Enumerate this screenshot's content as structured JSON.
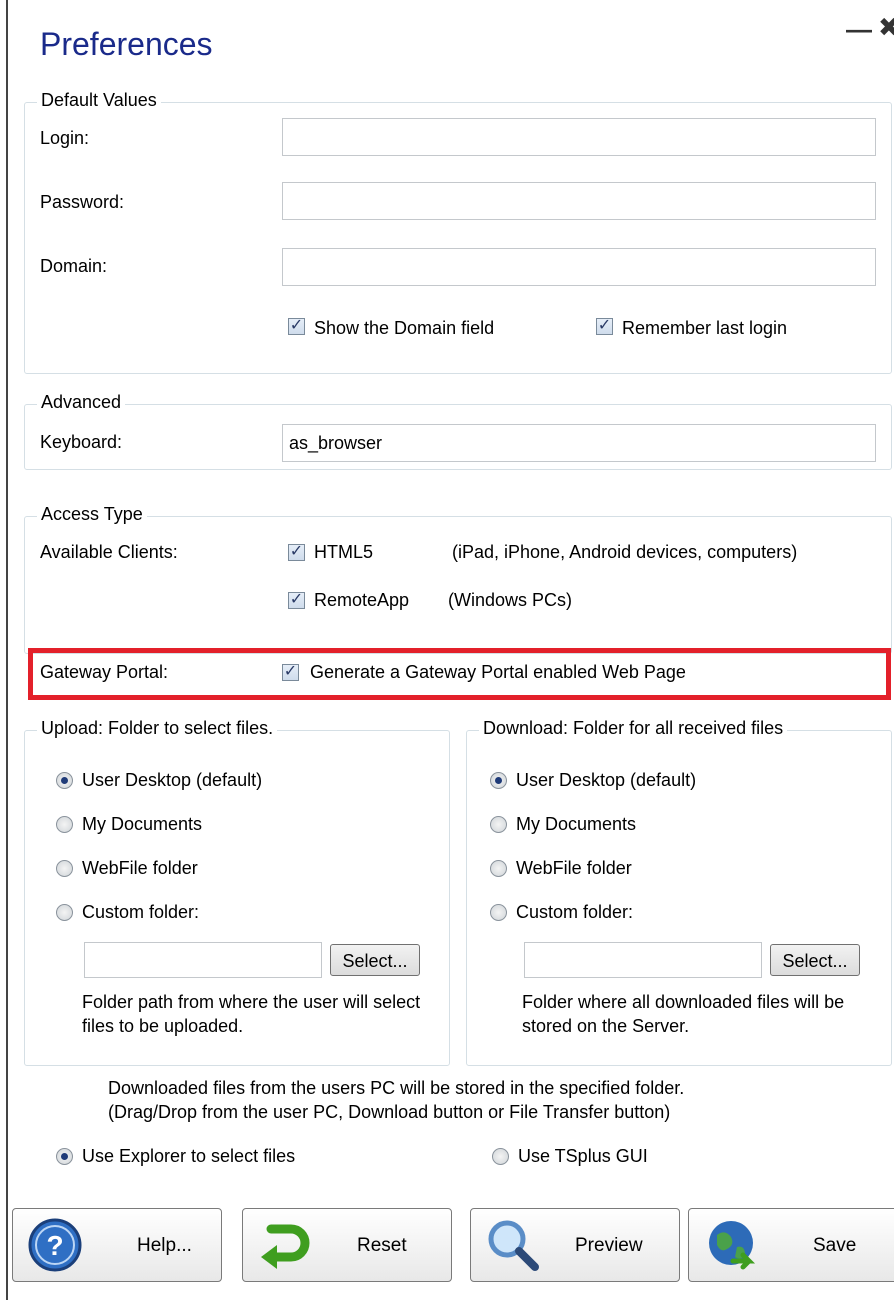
{
  "window": {
    "title": "Preferences",
    "minimize": "—",
    "close": "✖"
  },
  "default_values": {
    "legend": "Default Values",
    "login_label": "Login:",
    "login_value": "",
    "password_label": "Password:",
    "password_value": "",
    "domain_label": "Domain:",
    "domain_value": "",
    "show_domain_label": "Show the Domain field",
    "show_domain_checked": true,
    "remember_login_label": "Remember last login",
    "remember_login_checked": true
  },
  "advanced": {
    "legend": "Advanced",
    "keyboard_label": "Keyboard:",
    "keyboard_value": "as_browser"
  },
  "access_type": {
    "legend": "Access Type",
    "clients_label": "Available Clients:",
    "html5_label": "HTML5",
    "html5_desc": "(iPad, iPhone, Android devices, computers)",
    "html5_checked": true,
    "remoteapp_label": "RemoteApp",
    "remoteapp_desc": "(Windows PCs)",
    "remoteapp_checked": true,
    "gateway_label": "Gateway Portal:",
    "gateway_option": "Generate a Gateway Portal enabled Web Page",
    "gateway_checked": true
  },
  "upload": {
    "legend": "Upload: Folder to select files.",
    "options": [
      "User Desktop (default)",
      "My Documents",
      "WebFile folder",
      "Custom folder:"
    ],
    "selected": "User Desktop (default)",
    "custom_value": "",
    "select_button": "Select...",
    "note": "Folder path from where the user will select files to be uploaded."
  },
  "download": {
    "legend": "Download: Folder for all received files",
    "options": [
      "User Desktop (default)",
      "My Documents",
      "WebFile folder",
      "Custom folder:"
    ],
    "selected": "User Desktop (default)",
    "custom_value": "",
    "select_button": "Select...",
    "note": "Folder where all downloaded files will be stored on the Server."
  },
  "transfer_note_1": "Downloaded files from the users PC will be stored in the specified folder.",
  "transfer_note_2": "(Drag/Drop from the user PC, Download button or File Transfer button)",
  "file_gui": {
    "explorer_label": "Use Explorer to select files",
    "tsplus_label": "Use TSplus GUI",
    "selected": "Use Explorer to select files"
  },
  "buttons": {
    "help": "Help...",
    "reset": "Reset",
    "preview": "Preview",
    "save": "Save"
  },
  "colors": {
    "title": "#1a2a8a",
    "highlight": "#e3202a"
  },
  "icons": [
    "help-icon",
    "reset-arrow-icon",
    "magnifier-icon",
    "globe-icon"
  ]
}
